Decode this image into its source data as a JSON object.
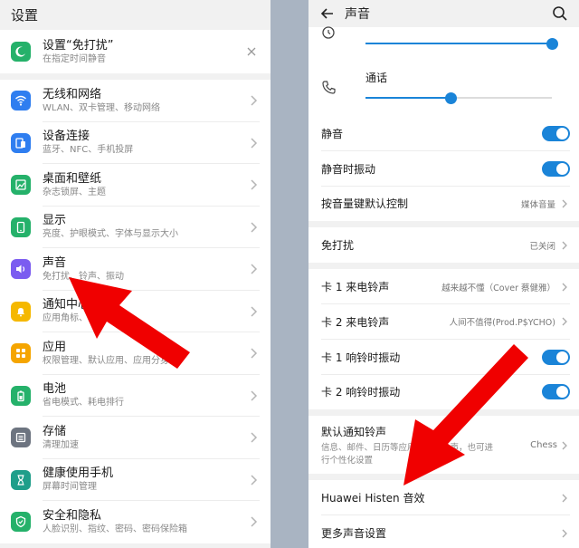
{
  "left": {
    "header_title": "设置",
    "dnd": {
      "title": "设置“免打扰”",
      "subtitle": "在指定时间静音"
    },
    "items": [
      {
        "title": "无线和网络",
        "subtitle": "WLAN、双卡管理、移动网络",
        "icon": "wifi-icon",
        "color": "#2f7ef0"
      },
      {
        "title": "设备连接",
        "subtitle": "蓝牙、NFC、手机投屏",
        "icon": "device-connect-icon",
        "color": "#2f7ef0"
      },
      {
        "title": "桌面和壁纸",
        "subtitle": "杂志锁屏、主题",
        "icon": "wallpaper-icon",
        "color": "#25b16a"
      },
      {
        "title": "显示",
        "subtitle": "亮度、护眼模式、字体与显示大小",
        "icon": "display-icon",
        "color": "#25b16a"
      },
      {
        "title": "声音",
        "subtitle": "免打扰、铃声、振动",
        "icon": "sound-icon",
        "color": "#7b5cf0"
      },
      {
        "title": "通知中心",
        "subtitle": "应用角标、锁屏通知",
        "icon": "bell-icon",
        "color": "#f5b800"
      },
      {
        "title": "应用",
        "subtitle": "权限管理、默认应用、应用分身",
        "icon": "apps-icon",
        "color": "#f5a500"
      },
      {
        "title": "电池",
        "subtitle": "省电模式、耗电排行",
        "icon": "battery-icon",
        "color": "#25b16a"
      },
      {
        "title": "存储",
        "subtitle": "清理加速",
        "icon": "storage-icon",
        "color": "#6d7480"
      },
      {
        "title": "健康使用手机",
        "subtitle": "屏幕时间管理",
        "icon": "hourglass-icon",
        "color": "#1f9e8a"
      },
      {
        "title": "安全和隐私",
        "subtitle": "人脸识别、指纹、密码、密码保险箱",
        "icon": "shield-icon",
        "color": "#25b16a"
      }
    ]
  },
  "right": {
    "header_title": "声音",
    "volume": {
      "call_label": "通话",
      "top_level": 1.0,
      "call_level": 0.46
    },
    "group1": [
      {
        "label": "静音",
        "type": "toggle",
        "on": true
      },
      {
        "label": "静音时振动",
        "type": "toggle",
        "on": true
      },
      {
        "label": "按音量键默认控制",
        "type": "value",
        "value": "媒体音量"
      }
    ],
    "dnd_row": {
      "label": "免打扰",
      "value": "已关闭"
    },
    "group3": [
      {
        "label": "卡 1 来电铃声",
        "type": "value",
        "value": "越来越不懂（Cover 蔡健雅）"
      },
      {
        "label": "卡 2 来电铃声",
        "type": "value",
        "value": "人间不值得(Prod.P$YCHO)"
      },
      {
        "label": "卡 1 响铃时振动",
        "type": "toggle",
        "on": true
      },
      {
        "label": "卡 2 响铃时振动",
        "type": "toggle",
        "on": true
      }
    ],
    "notify_row": {
      "label": "默认通知铃声",
      "desc1": "信息、邮件、日历等应用的默认铃声，也可进",
      "desc2": "行个性化设置",
      "value": "Chess"
    },
    "histen_row": {
      "label": "Huawei Histen 音效"
    },
    "more_row": {
      "label": "更多声音设置"
    }
  },
  "colors": {
    "accent": "#1a84d8",
    "arrow": "#f00000"
  }
}
